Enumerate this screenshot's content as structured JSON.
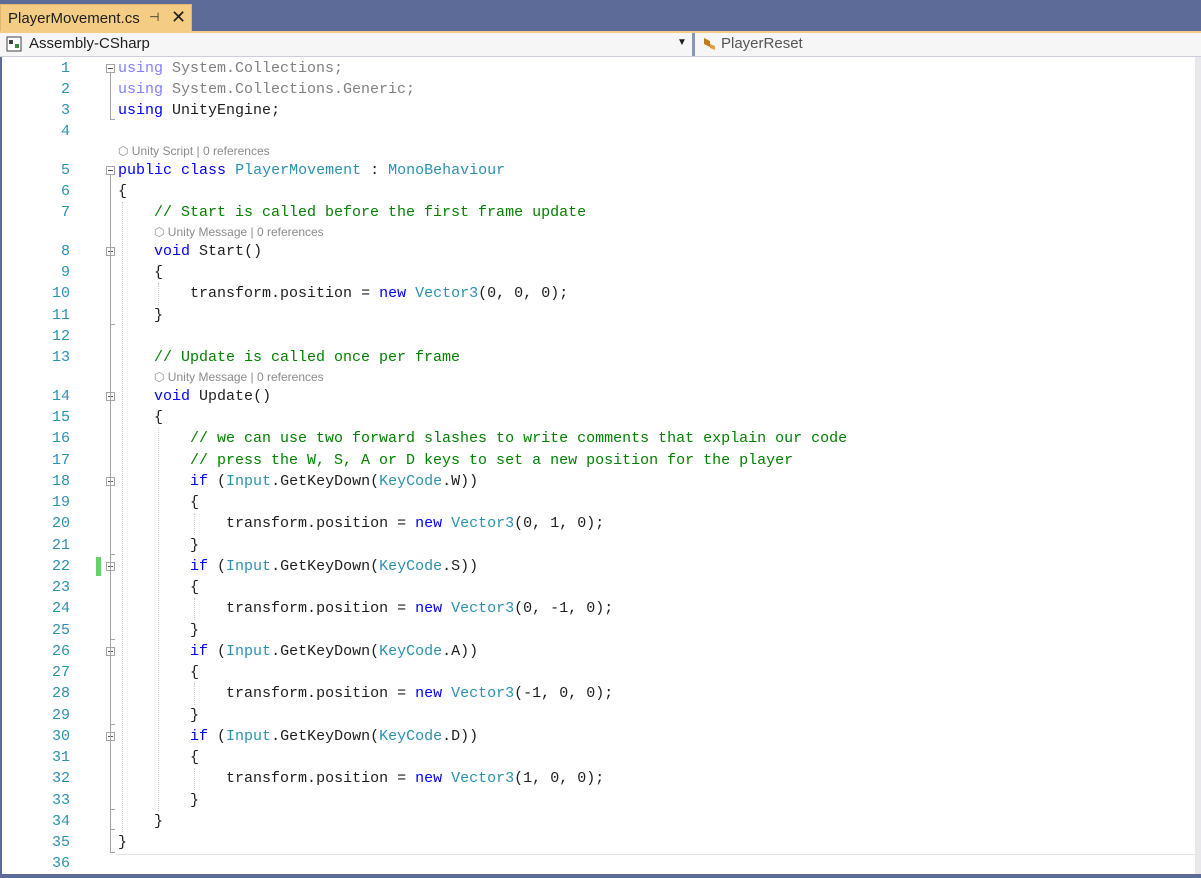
{
  "tab": {
    "title": "PlayerMovement.cs",
    "pin": "⊣",
    "close": "✕"
  },
  "nav": {
    "project": "Assembly-CSharp",
    "member": "PlayerReset"
  },
  "lens": {
    "script": "Unity Script | 0 references",
    "message": "Unity Message | 0 references"
  },
  "lines": [
    {
      "n": "1",
      "code": "using System.Collections;"
    },
    {
      "n": "2",
      "code": "using System.Collections.Generic;"
    },
    {
      "n": "3",
      "code": "using UnityEngine;"
    },
    {
      "n": "4",
      "code": ""
    },
    {
      "n": "5",
      "code": "public class PlayerMovement : MonoBehaviour"
    },
    {
      "n": "6",
      "code": "{"
    },
    {
      "n": "7",
      "code": "    // Start is called before the first frame update"
    },
    {
      "n": "8",
      "code": "    void Start()"
    },
    {
      "n": "9",
      "code": "    {"
    },
    {
      "n": "10",
      "code": "        transform.position = new Vector3(0, 0, 0);"
    },
    {
      "n": "11",
      "code": "    }"
    },
    {
      "n": "12",
      "code": ""
    },
    {
      "n": "13",
      "code": "    // Update is called once per frame"
    },
    {
      "n": "14",
      "code": "    void Update()"
    },
    {
      "n": "15",
      "code": "    {"
    },
    {
      "n": "16",
      "code": "        // we can use two forward slashes to write comments that explain our code"
    },
    {
      "n": "17",
      "code": "        // press the W, S, A or D keys to set a new position for the player"
    },
    {
      "n": "18",
      "code": "        if (Input.GetKeyDown(KeyCode.W))"
    },
    {
      "n": "19",
      "code": "        {"
    },
    {
      "n": "20",
      "code": "            transform.position = new Vector3(0, 1, 0);"
    },
    {
      "n": "21",
      "code": "        }"
    },
    {
      "n": "22",
      "code": "        if (Input.GetKeyDown(KeyCode.S))"
    },
    {
      "n": "23",
      "code": "        {"
    },
    {
      "n": "24",
      "code": "            transform.position = new Vector3(0, -1, 0);"
    },
    {
      "n": "25",
      "code": "        }"
    },
    {
      "n": "26",
      "code": "        if (Input.GetKeyDown(KeyCode.A))"
    },
    {
      "n": "27",
      "code": "        {"
    },
    {
      "n": "28",
      "code": "            transform.position = new Vector3(-1, 0, 0);"
    },
    {
      "n": "29",
      "code": "        }"
    },
    {
      "n": "30",
      "code": "        if (Input.GetKeyDown(KeyCode.D))"
    },
    {
      "n": "31",
      "code": "        {"
    },
    {
      "n": "32",
      "code": "            transform.position = new Vector3(1, 0, 0);"
    },
    {
      "n": "33",
      "code": "        }"
    },
    {
      "n": "34",
      "code": "    }"
    },
    {
      "n": "35",
      "code": "}"
    },
    {
      "n": "36",
      "code": ""
    }
  ],
  "colors": {
    "keyword": "#0000ff",
    "type": "#2b91af",
    "comment": "#008000",
    "line_number": "#2b91af",
    "tab_active": "#f5cc84",
    "frame": "#5d6b99",
    "change_marker": "#6ad06a"
  },
  "icons": {
    "project": "csharp-project-icon",
    "member": "method-icon"
  }
}
